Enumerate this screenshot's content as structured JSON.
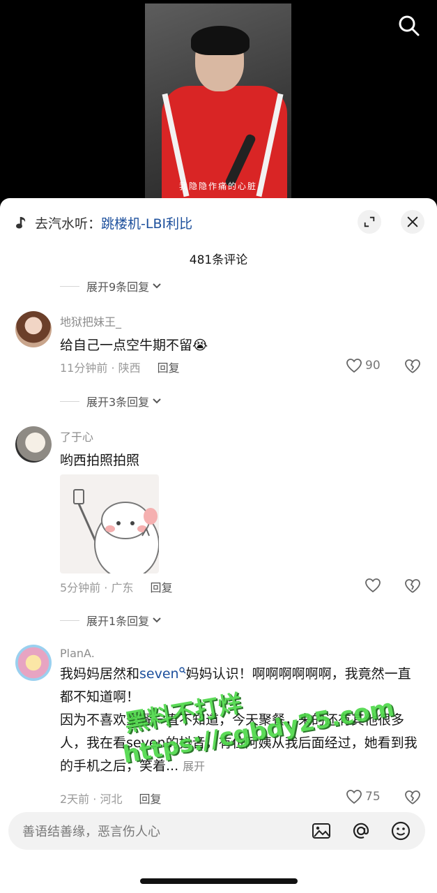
{
  "video": {
    "subtitle": "我隐隐作痛的心脏"
  },
  "music": {
    "prefix": "去汽水听：",
    "title": "跳楼机-LBI利比"
  },
  "comments_header": {
    "count_title": "481条评论"
  },
  "expand_rows": [
    "展开9条回复",
    "展开3条回复",
    "展开1条回复"
  ],
  "comments": [
    {
      "username": "地狱把妹王_",
      "text": "给自己一点空牛期不留😭",
      "time_location": "11分钟前 · 陕西",
      "reply": "回复",
      "likes": "90"
    },
    {
      "username": "了于心",
      "text": "哟西拍照拍照",
      "time_location": "5分钟前 · 广东",
      "reply": "回复",
      "likes": ""
    },
    {
      "username": "PlanA.",
      "text_part1": "我妈妈居然和",
      "mention": "seven",
      "text_part2": "妈妈认识！啊啊啊啊啊啊，我竟然一直都不知道啊！",
      "text_line2": "因为不喜欢聚餐一直不知道，今天聚餐，来的还有其他很多人，我在看seven的抖音，有位阿姨从我后面经过，她看到我的手机之后，笑着...",
      "expand_label": "展开",
      "time_location": "2天前 · 河北",
      "reply": "回复",
      "likes": "75"
    }
  ],
  "input": {
    "placeholder": "善语结善缘，恶言伤人心"
  },
  "watermark": {
    "line1": "黑料不打烊",
    "line2": "https://cgbdy25.com"
  },
  "icons": [
    "search-icon",
    "music-note-icon",
    "expand-icon",
    "close-icon",
    "chevron-down-icon",
    "heart-icon",
    "broken-heart-icon",
    "image-icon",
    "at-icon",
    "emoji-icon"
  ]
}
